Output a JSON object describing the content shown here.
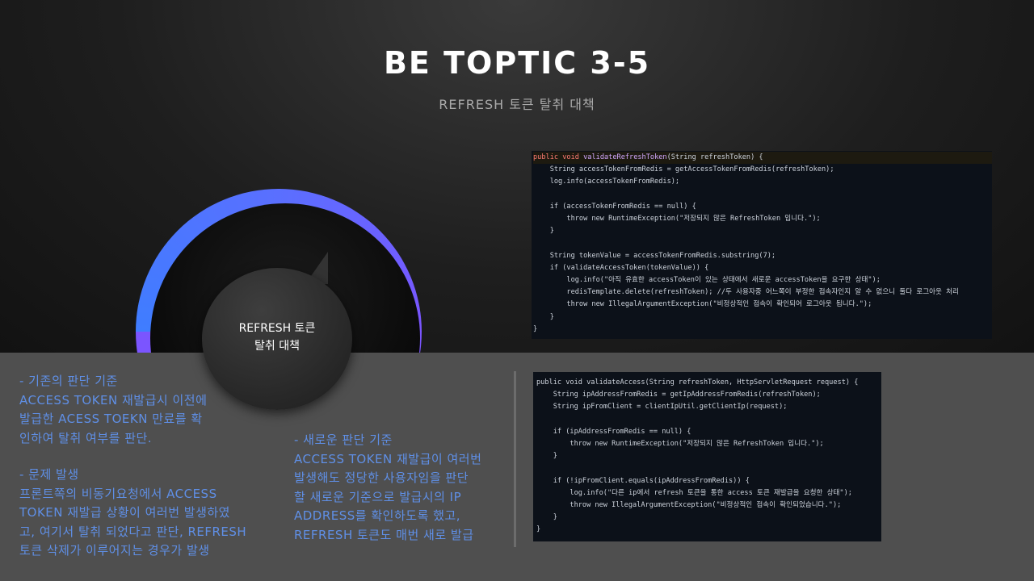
{
  "header": {
    "title": "BE TOPTIC 3-5",
    "subtitle": "REFRESH 토큰 탈취 대책"
  },
  "bubble": {
    "line1": "REFRESH 토큰",
    "line2": "탈취 대책"
  },
  "left_notes": {
    "section1": [
      "- 기존의 판단 기준",
      "ACCESS TOKEN 재발급시 이전에",
      "발급한 ACESS TOEKN 만료를 확",
      "인하여 탈취 여부를 판단."
    ],
    "section2": [
      "- 문제 발생",
      "프론트쪽의 비동기요청에서 ACCESS",
      "TOKEN 재발급 상황이 여러번 발생하였",
      "고, 여기서 탈취 되었다고 판단, REFRESH",
      "토큰 삭제가 이루어지는 경우가 발생"
    ]
  },
  "mid_notes": [
    "- 새로운 판단 기준",
    "ACCESS TOKEN 재발급이 여러번",
    "발생해도 정당한 사용자임을 판단",
    "할 새로운 기준으로 발급시의 IP",
    "ADDRESS를 확인하도록 했고,",
    "REFRESH 토큰도 매번 새로 발급"
  ],
  "code_block_1": [
    "public void validateRefreshToken(String refreshToken) {",
    "    String accessTokenFromRedis = getAccessTokenFromRedis(refreshToken);",
    "    log.info(accessTokenFromRedis);",
    "",
    "    if (accessTokenFromRedis == null) {",
    "        throw new RuntimeException(\"저장되지 않은 RefreshToken 입니다.\");",
    "    }",
    "",
    "    String tokenValue = accessTokenFromRedis.substring(7);",
    "    if (validateAccessToken(tokenValue)) {",
    "        log.info(\"아직 유효한 accessToken이 있는 상태에서 새로운 accessToken을 요구한 상태\");",
    "        redisTemplate.delete(refreshToken); //두 사용자중 어느쪽이 부정한 접속자인지 알 수 없으니 둘다 로그아웃 처리",
    "        throw new IllegalArgumentException(\"비정상적인 접속이 확인되어 로그아웃 됩니다.\");",
    "    }",
    "}"
  ],
  "code_block_2": [
    "public void validateAccess(String refreshToken, HttpServletRequest request) {",
    "    String ipAddressFromRedis = getIpAddressFromRedis(refreshToken);",
    "    String ipFromClient = clientIpUtil.getClientIp(request);",
    "",
    "    if (ipAddressFromRedis == null) {",
    "        throw new RuntimeException(\"저장되지 않은 RefreshToken 입니다.\");",
    "    }",
    "",
    "    if (!ipFromClient.equals(ipAddressFromRedis)) {",
    "        log.info(\"다른 ip에서 refresh 토큰을 통한 access 토큰 재발급을 요청한 상태\");",
    "        throw new IllegalArgumentException(\"비정상적인 접속이 확인되었습니다.\");",
    "    }",
    "}"
  ],
  "colors": {
    "accent_blue": "#3f7dff",
    "accent_purple": "#7b55ff",
    "note_text": "#5f8fe6"
  }
}
